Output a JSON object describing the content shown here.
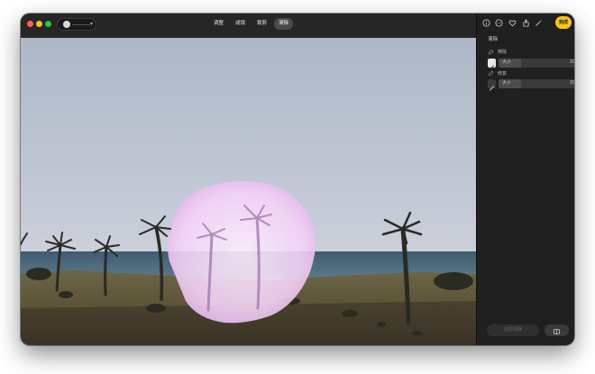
{
  "toolbar": {
    "tabs": [
      {
        "label": "调整",
        "active": false
      },
      {
        "label": "滤镜",
        "active": false
      },
      {
        "label": "裁剪",
        "active": false
      },
      {
        "label": "清除",
        "active": true
      }
    ]
  },
  "sidebar": {
    "done_label": "完成",
    "section_title": "清除",
    "erase": {
      "label": "擦除",
      "size_label": "大小",
      "size_value": "30",
      "size_fraction": 0.28
    },
    "repair": {
      "label": "修复",
      "size_label": "大小",
      "size_value": "30",
      "size_fraction": 0.28
    },
    "reset_label": "还原清除",
    "icons": [
      "info-icon",
      "more-icon",
      "favorite-heart-icon",
      "share-icon",
      "magic-wand-icon"
    ]
  },
  "colors": {
    "accent": "#f5c518",
    "brush_highlight": "#f2c9f5"
  }
}
